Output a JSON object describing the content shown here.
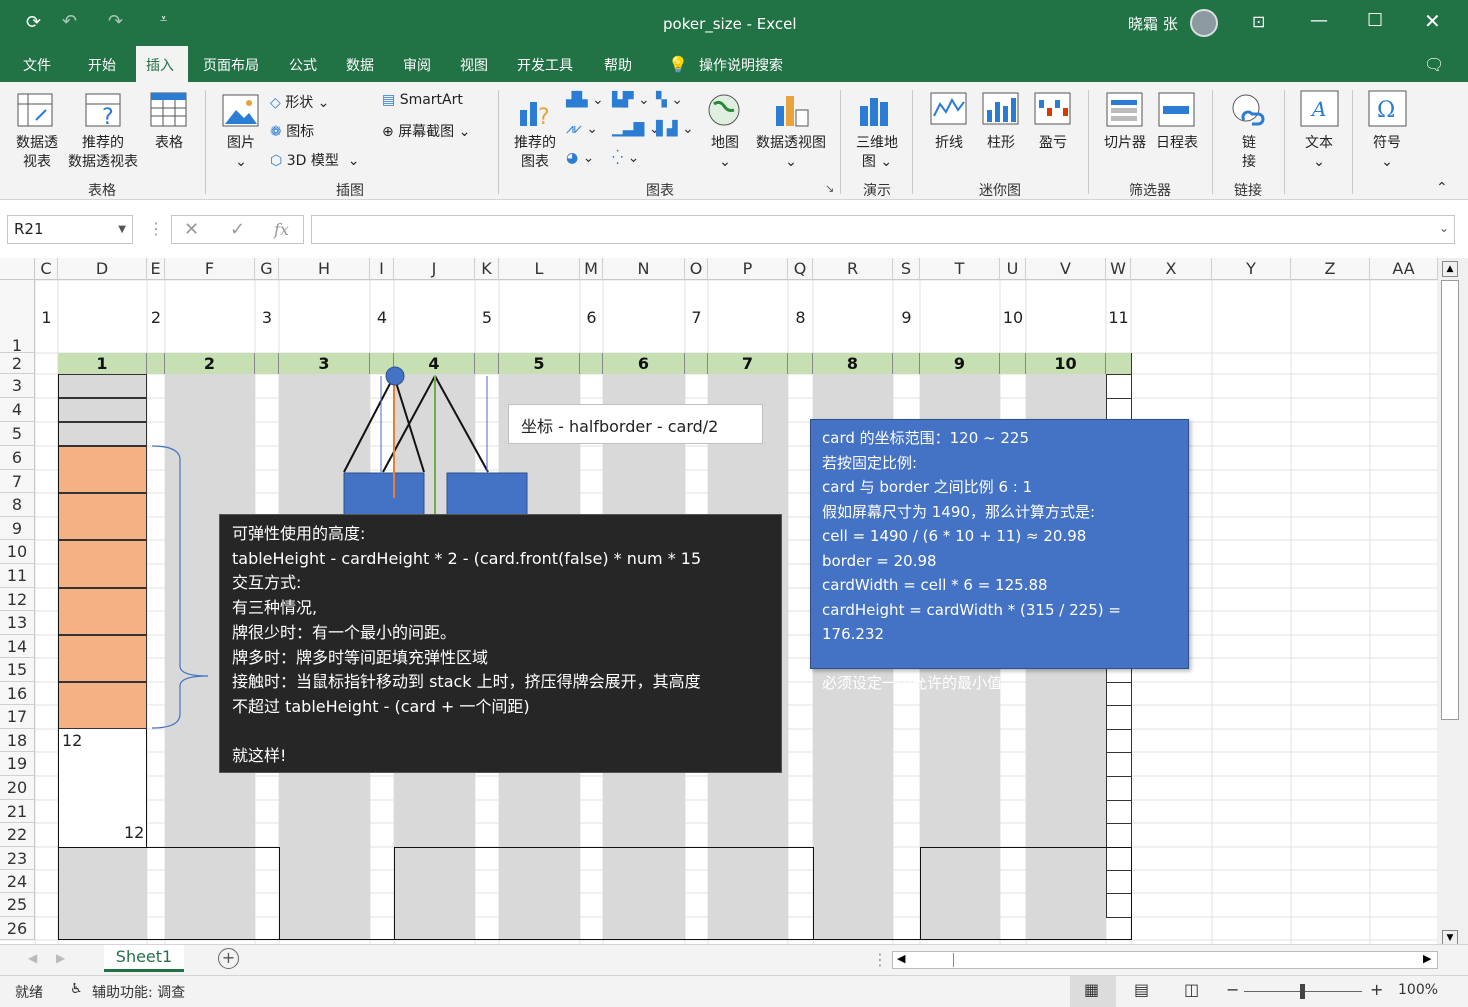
{
  "window": {
    "title": "poker_size  -  Excel",
    "user": "晓霜 张"
  },
  "tabs": [
    "文件",
    "开始",
    "插入",
    "页面布局",
    "公式",
    "数据",
    "审阅",
    "视图",
    "开发工具",
    "帮助"
  ],
  "active_tab": "插入",
  "search_label": "操作说明搜索",
  "ribbon": {
    "tables": {
      "label": "表格",
      "pivot": "数据透\n视表",
      "rec_pivot": "推荐的\n数据透视表",
      "table": "表格"
    },
    "illustrations": {
      "label": "插图",
      "pictures": "图片",
      "shapes": "形状",
      "icons": "图标",
      "models3d": "3D 模型",
      "smartart": "SmartArt",
      "screenshot": "屏幕截图"
    },
    "charts": {
      "label": "图表",
      "rec_charts": "推荐的\n图表",
      "maps": "地图",
      "pivot_chart": "数据透视图"
    },
    "tours": {
      "label": "演示",
      "map3d": "三维地\n图"
    },
    "sparklines": {
      "label": "迷你图",
      "line": "折线",
      "column": "柱形",
      "winloss": "盈亏"
    },
    "filters": {
      "label": "筛选器",
      "slicer": "切片器",
      "timeline": "日程表"
    },
    "links": {
      "label": "链接",
      "link": "链\n接"
    },
    "text": {
      "label": "文本"
    },
    "symbols": {
      "label": "符号"
    }
  },
  "formula_bar": {
    "name_box": "R21",
    "fx": "fx",
    "formula": ""
  },
  "columns": [
    "C",
    "D",
    "E",
    "F",
    "G",
    "H",
    "I",
    "J",
    "K",
    "L",
    "M",
    "N",
    "O",
    "P",
    "Q",
    "R",
    "S",
    "T",
    "U",
    "V",
    "W",
    "X",
    "Y",
    "Z",
    "AA"
  ],
  "rows": [
    "1",
    "2",
    "3",
    "4",
    "5",
    "6",
    "7",
    "8",
    "9",
    "10",
    "11",
    "12",
    "13",
    "14",
    "15",
    "16",
    "17",
    "18",
    "19",
    "20",
    "21",
    "22",
    "23",
    "24",
    "25",
    "26"
  ],
  "row1_numbers": [
    "1",
    "2",
    "3",
    "4",
    "5",
    "6",
    "7",
    "8",
    "9",
    "10",
    "11"
  ],
  "row2_headers": [
    "1",
    "2",
    "3",
    "4",
    "5",
    "6",
    "7",
    "8",
    "9",
    "10"
  ],
  "cell_values": {
    "d18": "12",
    "d22": "12"
  },
  "notes": {
    "formula": "坐标 - halfborder - card/2",
    "dark": [
      "可弹性使用的高度:",
      "tableHeight  - cardHeight * 2 -  (card.front(false) * num * 15",
      "交互方式:",
      "有三种情况,",
      "牌很少时：有一个最小的间距。",
      "牌多时：牌多时等间距填充弹性区域",
      "接触时：当鼠标指针移动到 stack 上时，挤压得牌会展开，其高度",
      "不超过 tableHeight - (card + 一个间距)",
      "",
      "就这样!"
    ],
    "blue": [
      "card 的坐标范围：120 ~ 225",
      "若按固定比例:",
      "card 与 border 之间比例 6 : 1",
      "假如屏幕尺寸为 1490，那么计算方式是:",
      "cell = 1490 / (6 * 10 + 11) ≈ 20.98",
      "border = 20.98",
      "cardWidth = cell * 6 = 125.88",
      "cardHeight = cardWidth * (315 / 225) = 176.232",
      "",
      "必须设定一个允许的最小值。"
    ]
  },
  "sheet_tab": "Sheet1",
  "status": {
    "ready": "就绪",
    "accessibility": "辅助功能: 调查",
    "zoom": "100%"
  },
  "colors": {
    "excel_green": "#217346",
    "header_green": "#c6e0b4",
    "orange": "#f4b183",
    "blue_note": "#4472c4",
    "dark_note": "#262626"
  }
}
